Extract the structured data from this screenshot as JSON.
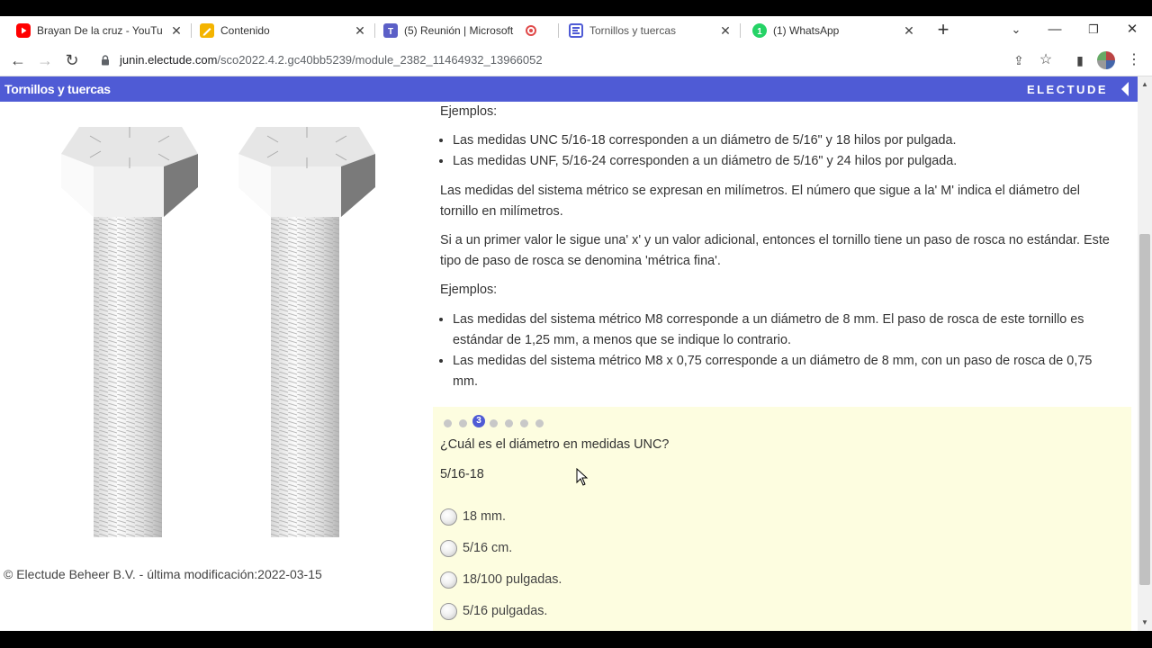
{
  "browser": {
    "tabs": [
      {
        "title": "Brayan De la cruz - YouTube",
        "icon": "youtube-icon",
        "color": "#ff0000"
      },
      {
        "title": "Contenido",
        "icon": "notes-icon",
        "color": "#f4b400"
      },
      {
        "title": "(5) Reunión | Microsoft T",
        "icon": "teams-icon",
        "color": "#5b5fc7"
      },
      {
        "title": "Tornillos y tuercas",
        "icon": "electude-icon",
        "color": "#4f5bd5"
      },
      {
        "title": "(1) WhatsApp",
        "icon": "whatsapp-icon",
        "color": "#25d366"
      }
    ],
    "new_tab": "+",
    "url_host": "junin.electude.com",
    "url_path": "/sco2022.4.2.gc40bb5239/module_2382_11464932_13966052"
  },
  "app": {
    "title": "Tornillos y tuercas",
    "brand": "ELECTUDE",
    "brand_color": "#4f5bd5"
  },
  "left": {
    "image": "hex-bolts-illustration",
    "copyright": "© Electude Beheer B.V. - última modificación:2022-03-15"
  },
  "text": {
    "examples1_heading": "Ejemplos:",
    "examples1": [
      "Las medidas UNC 5/16-18 corresponden a un diámetro de 5/16\" y 18 hilos por pulgada.",
      "Las medidas UNF, 5/16-24 corresponden a un diámetro de 5/16\" y 24 hilos por pulgada."
    ],
    "para_metric": "Las medidas del sistema métrico se expresan en milímetros. El número que sigue a la' M' indica el diámetro del tornillo en milímetros.",
    "para_fine": "Si a un primer valor le sigue una' x' y un valor adicional, entonces el tornillo tiene un paso de rosca no estándar. Este tipo de paso de rosca se denomina 'métrica fina'.",
    "examples2_heading": "Ejemplos:",
    "examples2": [
      "Las medidas del sistema métrico M8 corresponde a un diámetro de 8 mm. El paso de rosca de este tornillo es estándar de 1,25 mm, a menos que se indique lo contrario.",
      "Las medidas del sistema métrico M8 x 0,75 corresponde a un diámetro de 8 mm, con un paso de rosca de 0,75 mm."
    ]
  },
  "quiz": {
    "current_step": "3",
    "question": "¿Cuál es el diámetro en medidas UNC?",
    "subject": "5/16-18",
    "options": [
      "18 mm.",
      "5/16 cm.",
      "18/100 pulgadas.",
      "5/16 pulgadas."
    ]
  }
}
